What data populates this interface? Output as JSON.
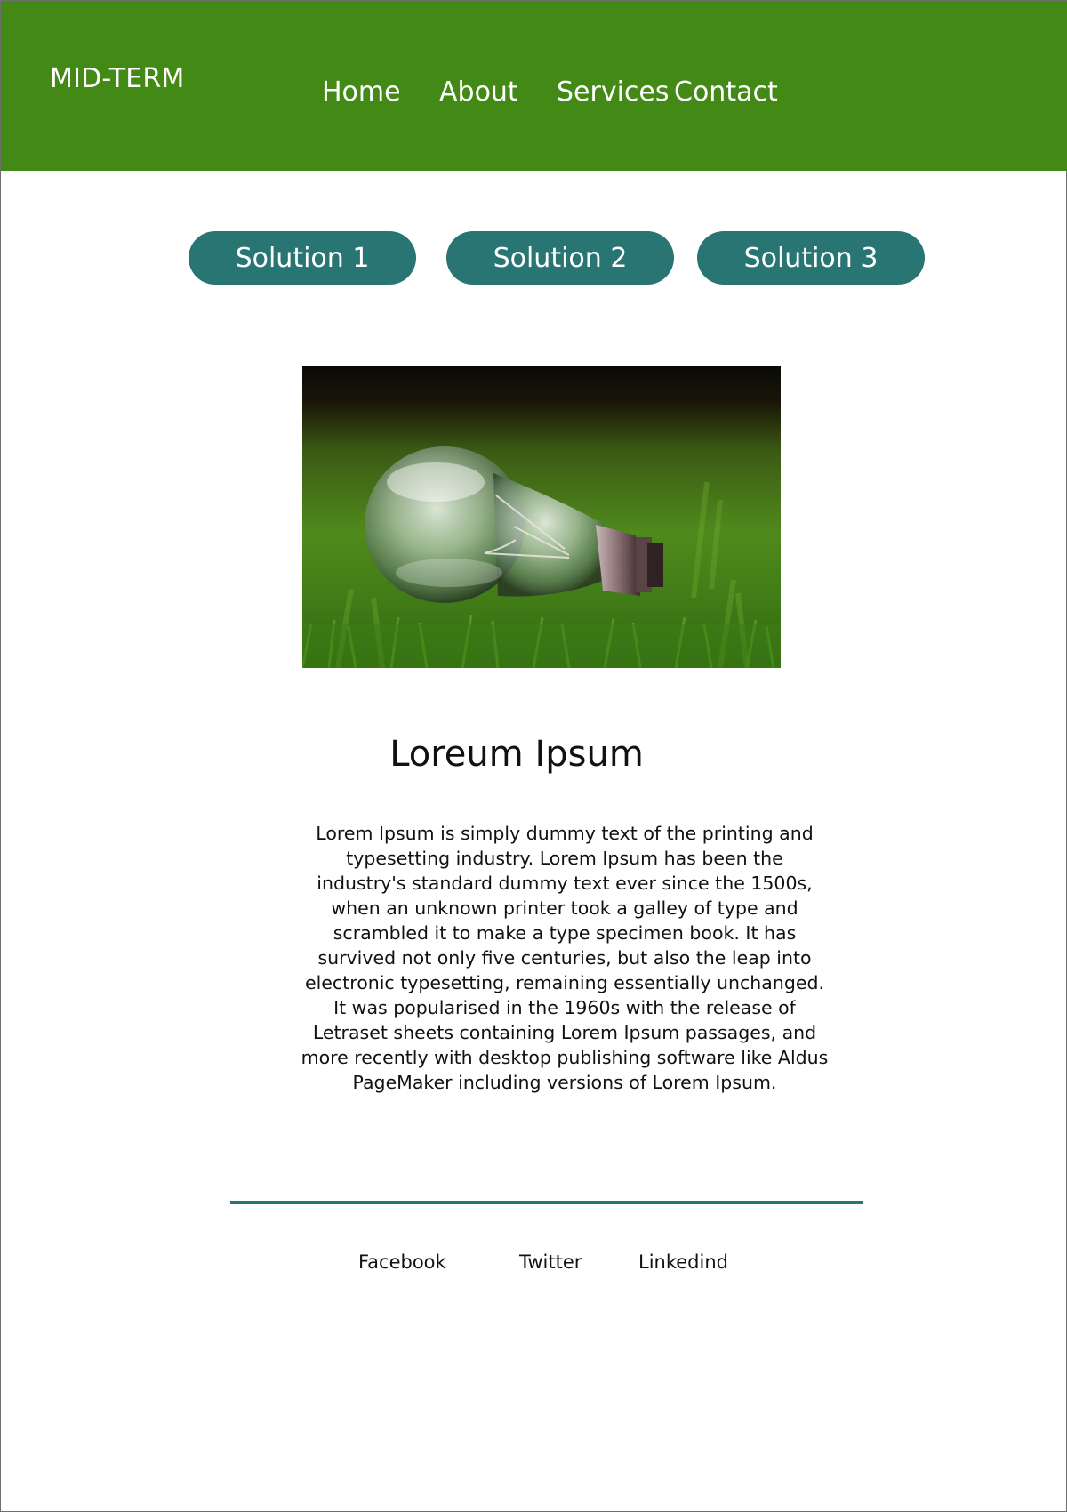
{
  "header": {
    "brand": "MID-TERM",
    "nav": [
      "Home",
      "About",
      "Services",
      "Contact"
    ]
  },
  "solutions": [
    "Solution 1",
    "Solution 2",
    "Solution 3"
  ],
  "content": {
    "title": "Loreum Ipsum",
    "paragraph": "Lorem Ipsum is simply dummy text of the printing and typesetting industry. Lorem Ipsum has been the industry's standard dummy text ever since the 1500s, when an unknown printer took a galley of type and scrambled it to make a type specimen book. It has survived not only five centuries, but also the leap into electronic typesetting, remaining essentially unchanged. It was popularised in the 1960s with the release of Letraset sheets containing Lorem Ipsum passages, and more recently with desktop publishing software like Aldus PageMaker including versions of Lorem Ipsum."
  },
  "footer": {
    "links": [
      "Facebook",
      "Twitter",
      "Linkedind"
    ]
  },
  "colors": {
    "header_bg": "#428916",
    "button_bg": "#287574",
    "divider": "#287574"
  },
  "hero_image": {
    "icon": "lightbulb-on-grass-photo"
  }
}
